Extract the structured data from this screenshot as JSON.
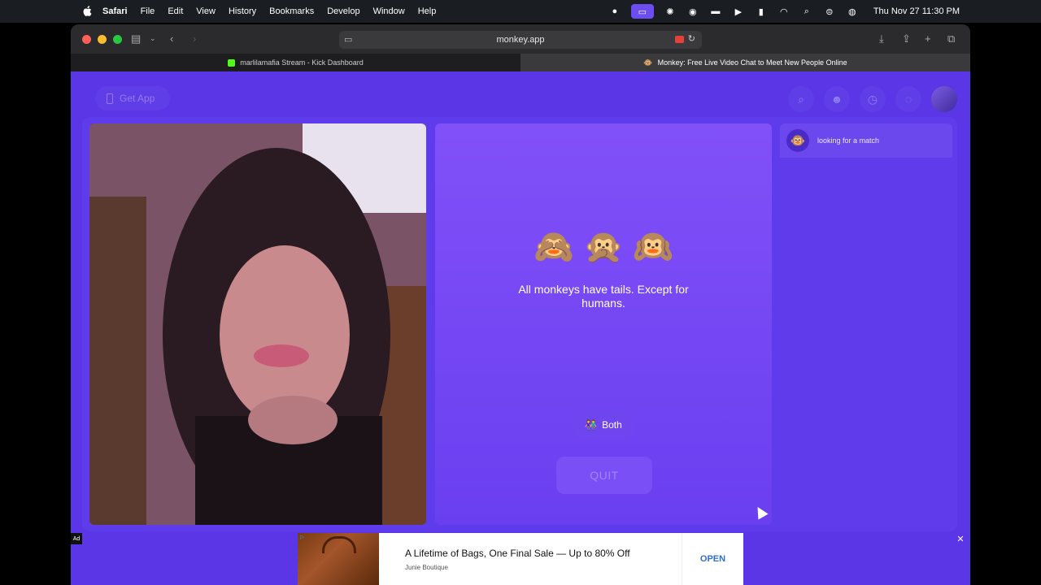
{
  "menubar": {
    "app": "Safari",
    "items": [
      "File",
      "Edit",
      "View",
      "History",
      "Bookmarks",
      "Develop",
      "Window",
      "Help"
    ],
    "clock": "Thu Nov 27  11:30 PM"
  },
  "browser": {
    "address": "monkey.app",
    "tabs": [
      {
        "label": "marlilamafia Stream - Kick Dashboard"
      },
      {
        "label": "Monkey: Free Live Video Chat to Meet New People Online"
      }
    ]
  },
  "page": {
    "get_app": "Get App",
    "monkeys": "🙈 🙊 🙉",
    "tagline": "All monkeys have tails. Except for humans.",
    "both_label": "Both",
    "quit_label": "QUIT",
    "match_status": "looking for a match",
    "match_icon": "🐵"
  },
  "ad": {
    "label": "Ad",
    "title": "A Lifetime of Bags, One Final Sale — Up to 80% Off",
    "advertiser": "Junie Boutique",
    "cta": "OPEN"
  }
}
